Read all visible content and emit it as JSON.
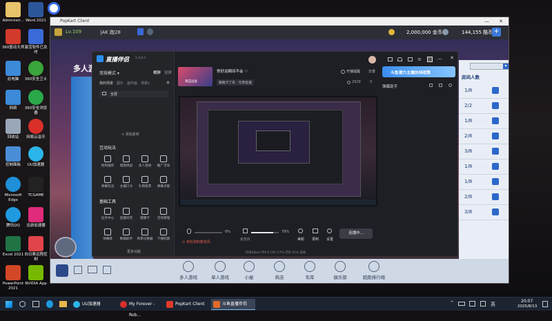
{
  "desktop": {
    "icons": [
      {
        "label": "Administr...",
        "color": "#e8c46a"
      },
      {
        "label": "Word 2021",
        "color": "#2b579a"
      },
      {
        "label": "360驱动大师",
        "color": "#d23a2c"
      },
      {
        "label": "激活软件已及时",
        "color": "#3a6ad8"
      },
      {
        "label": "此电脑",
        "color": "#3c8ad8"
      },
      {
        "label": "360安全卫士",
        "color": "#3aa53a"
      },
      {
        "label": "网络",
        "color": "#3c8ad8"
      },
      {
        "label": "360安全浏览器",
        "color": "#2aa84a"
      },
      {
        "label": "回收站",
        "color": "#9aa7b8"
      },
      {
        "label": "网易云音乐",
        "color": "#d9302b"
      },
      {
        "label": "控制面板",
        "color": "#4a8ed8"
      },
      {
        "label": "UU加速器",
        "color": "#2bb5e8"
      },
      {
        "label": "Microsoft Edge",
        "color": "#1f8fd8"
      },
      {
        "label": "TCGAME",
        "color": "#222222"
      },
      {
        "label": "腾讯QQ",
        "color": "#1f9ae0"
      },
      {
        "label": "迅游加速器",
        "color": "#e02a7a"
      },
      {
        "label": "Excel 2021",
        "color": "#217346"
      },
      {
        "label": "向日葵远程控制",
        "color": "#e0444a"
      },
      {
        "label": "PowerPoint 2021",
        "color": "#d24726"
      },
      {
        "label": "NVIDIA App",
        "color": "#76b900"
      }
    ]
  },
  "game": {
    "window_title": "PopKart Client",
    "level": "Lv.109",
    "player": "|AK 跑28",
    "coins": "2,000,000 金币",
    "points": "144,155 酷币",
    "mode_title": "多人游",
    "rooms_header": "房间人数",
    "room_counts": [
      "1/8",
      "2/2",
      "1/8",
      "2/8",
      "3/8",
      "1/8",
      "1/8",
      "2/8",
      "3/8"
    ],
    "nav": [
      "多人游戏",
      "单人游戏",
      "小屋",
      "商店",
      "车库",
      "俱乐部",
      "跑跑排行榜"
    ]
  },
  "app": {
    "brand": "直播伴侣",
    "version": "5.4.0.1",
    "mode_label": "常规模式 ▾",
    "tab_landscape": "横屏",
    "tab_portrait": "竖屏",
    "scenes_label": "我的场景",
    "scene_tabs": [
      "图片",
      "画中画",
      "场景1"
    ],
    "item_fullscreen": "全屏",
    "add_material": "+ 添加素材",
    "interactive_label": "互动玩法",
    "interactive_items": [
      "抢购抽奖",
      "唱歌挑战",
      "多人连线",
      "推广活动",
      "弹幕玩法",
      "主播口令",
      "礼物投票",
      "弹幕点歌"
    ],
    "basic_tools_label": "基础工具",
    "basic_tools": [
      "任务中心",
      "直播日历",
      "健康卡",
      "活动管理",
      "弹幕库",
      "数据助手",
      "场景切换器",
      "下播标题"
    ],
    "more_features": "更多功能",
    "stream_title": "来自远处",
    "stream_title_suffix": "常好运瞬间不会 ♡",
    "category_tag": "跑跑卡丁车 · 元宵竞速",
    "viewers": "2929",
    "likes": "0",
    "open_recording": "开播提醒",
    "share": "分享",
    "banner": "斗鱼潜力主播扶持政策",
    "right_panel_title": "弹幕助手",
    "mic_label": "麦克风",
    "mic_value": "0%",
    "speaker_label": "扬声器",
    "speaker_value": "79%",
    "tools": [
      "美颜",
      "录制",
      "设置"
    ],
    "start_button": "连播中...",
    "warning": "⊙ 未检测到麦克风",
    "status_line": "码率0kb/s  FPS 0  CPU 27%  内存 51%  丢帧"
  },
  "taskbar": {
    "items": [
      {
        "label": "UU加速器",
        "color": "#2bb5e8",
        "active": false
      },
      {
        "label": "My Forever - Rob...",
        "color": "#d9302b",
        "active": false
      },
      {
        "label": "PopKart Client",
        "color": "#e03a2a",
        "active": false
      },
      {
        "label": "斗鱼直播伴侣",
        "color": "#e06a2a",
        "active": true
      }
    ],
    "time": "20:07",
    "date": "2025/8/13",
    "lang": "英"
  },
  "colors": {
    "accent": "#2c68c9",
    "stream_button": "#3a3d45",
    "warning": "#e05a4a"
  }
}
